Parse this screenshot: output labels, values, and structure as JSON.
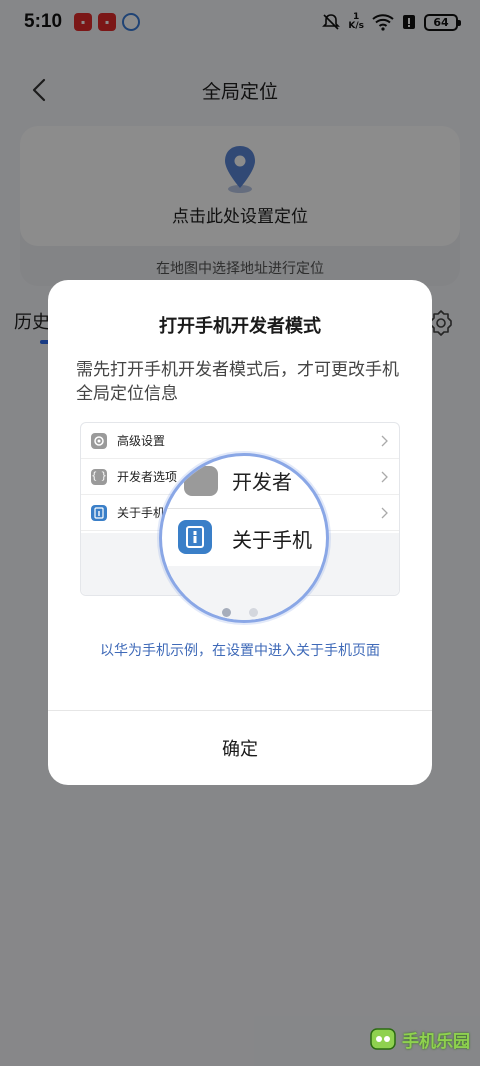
{
  "status_bar": {
    "time": "5:10",
    "net_speed_value": "1",
    "net_speed_unit": "K/s",
    "battery": "64",
    "icons": [
      "notification-app-icon",
      "notification-app-icon",
      "notification-app-icon",
      "mute-icon",
      "wifi-icon",
      "alert-icon",
      "battery-icon"
    ]
  },
  "header": {
    "title": "全局定位"
  },
  "location_card": {
    "action_label": "点击此处设置定位",
    "hint": "在地图中选择地址进行定位",
    "icon": "location-pin-icon"
  },
  "tabs": {
    "history_label": "历史"
  },
  "dialog": {
    "title": "打开手机开发者模式",
    "message": "需先打开手机开发者模式后，才可更改手机全局定位信息",
    "illustration": {
      "rows": [
        {
          "label": "高级设置",
          "icon": "gear-icon"
        },
        {
          "label": "开发者选项",
          "icon": "brackets-icon"
        },
        {
          "label": "关于手机",
          "icon": "phone-info-icon"
        }
      ],
      "magnified_top": "开发者",
      "magnified_main": "关于手机"
    },
    "pager": {
      "count": 2,
      "active": 1
    },
    "caption": "以华为手机示例，在设置中进入关于手机页面",
    "confirm_label": "确定"
  },
  "watermark": {
    "text": "手机乐园"
  },
  "colors": {
    "accent": "#2d6cf0",
    "caption": "#3f6ab8",
    "overlay": "rgba(0,0,0,0.45)"
  }
}
